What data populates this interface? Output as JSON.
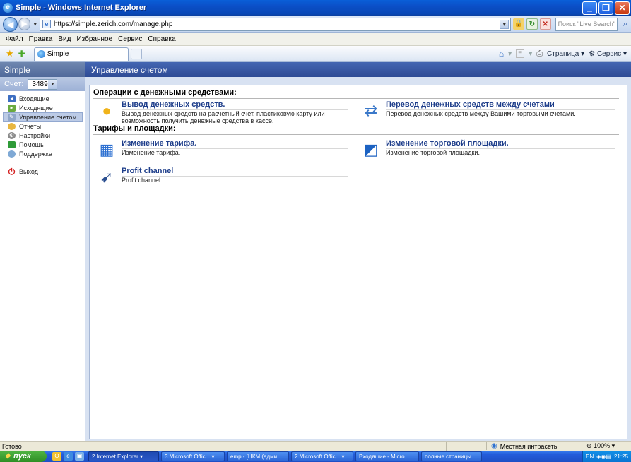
{
  "window": {
    "title": "Simple - Windows Internet Explorer"
  },
  "browser": {
    "url": "https://simple.zerich.com/manage.php",
    "search_placeholder": "Поиск \"Live Search\"",
    "menu": [
      "Файл",
      "Правка",
      "Вид",
      "Избранное",
      "Сервис",
      "Справка"
    ],
    "tab_title": "Simple",
    "commands": {
      "page": "Страница",
      "tools": "Сервис"
    }
  },
  "app": {
    "brand": "Simple",
    "page_title": "Управление счетом",
    "account_label": "Счет:",
    "account_value": "3489",
    "nav": [
      {
        "label": "Входящие",
        "icon": "inbox-icon"
      },
      {
        "label": "Исходящие",
        "icon": "outbox-icon"
      },
      {
        "label": "Управление счетом",
        "icon": "manage-icon",
        "active": true
      },
      {
        "label": "Отчеты",
        "icon": "reports-icon"
      },
      {
        "label": "Настройки",
        "icon": "settings-icon"
      },
      {
        "label": "Помощь",
        "icon": "help-icon"
      },
      {
        "label": "Поддержка",
        "icon": "support-icon"
      }
    ],
    "logout": "Выход",
    "sections": [
      {
        "title": "Операции с денежными средствами:",
        "items": [
          {
            "title": "Вывод денежных средств.",
            "desc": "Вывод денежных средств на расчетный счет, пластиковую карту или возможность получить денежные средства в кассе.",
            "icon": "coin-withdraw-icon"
          },
          {
            "title": "Перевод денежных средств между счетами",
            "desc": "Перевод денежных средств между Вашими торговыми счетами.",
            "icon": "transfer-icon"
          }
        ]
      },
      {
        "title": "Тарифы и площадки:",
        "items": [
          {
            "title": "Изменение тарифа.",
            "desc": "Изменение тарифа.",
            "icon": "calculator-icon"
          },
          {
            "title": "Изменение торговой площадки.",
            "desc": "Изменение торговой площадки.",
            "icon": "platform-icon"
          },
          {
            "title": "Profit channel",
            "desc": "Profit channel",
            "icon": "profit-channel-icon"
          }
        ]
      }
    ]
  },
  "statusbar": {
    "status": "Готово",
    "zone": "Местная интрасеть",
    "zoom": "100%"
  },
  "taskbar": {
    "start": "пуск",
    "buttons": [
      "2 Internet Explorer",
      "3 Microsoft Offic...",
      "emp - [ЦКМ (адми...",
      "2 Microsoft Offic...",
      "Входящие - Micro...",
      "полные страницы..."
    ],
    "lang": "EN",
    "clock": "21:25"
  },
  "colors": {
    "title_bar": "#0A4FC7",
    "app_header": "#2E4B95",
    "link_title": "#1D3D8A"
  }
}
